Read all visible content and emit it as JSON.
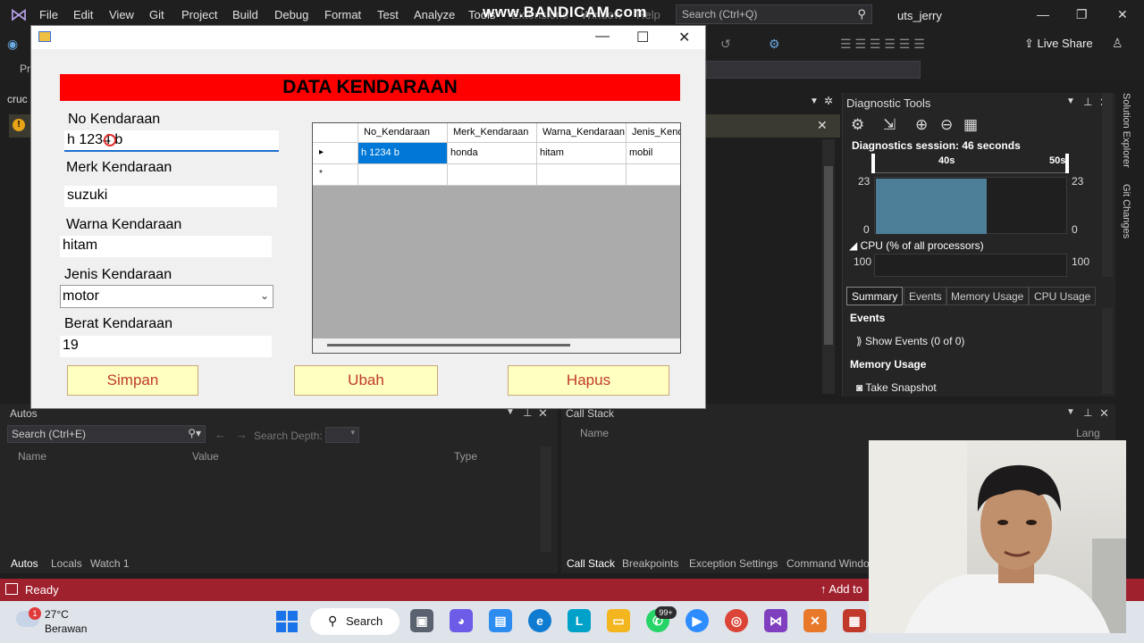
{
  "vs": {
    "menu": [
      "File",
      "Edit",
      "View",
      "Git",
      "Project",
      "Build",
      "Debug",
      "Format",
      "Test",
      "Analyze",
      "Tools",
      "Extensions",
      "Window",
      "Help"
    ],
    "search_placeholder": "Search (Ctrl+Q)",
    "solution_name": "uts_jerry",
    "live_share": "Live Share",
    "editor_tab": "cruc",
    "toolbar_prefix": "Pr",
    "watermark": "www.BANDICAM.com"
  },
  "diagnostics": {
    "title": "Diagnostic Tools",
    "session": "Diagnostics session: 46 seconds",
    "timeline_labels": [
      "40s",
      "50s"
    ],
    "y_top_left": "23",
    "y_bottom_left": "0",
    "y_top_right": "23",
    "y_bottom_right": "0",
    "cpu_header": "CPU (% of all processors)",
    "cpu_y_left": "100",
    "cpu_y_right": "100",
    "tabs": [
      "Summary",
      "Events",
      "Memory Usage",
      "CPU Usage"
    ],
    "events_header": "Events",
    "show_events": "Show Events (0 of 0)",
    "memory_header": "Memory Usage",
    "take_snapshot": "Take Snapshot",
    "side_tabs": [
      "Solution Explorer",
      "Git Changes"
    ]
  },
  "autos": {
    "title": "Autos",
    "search_placeholder": "Search (Ctrl+E)",
    "search_depth": "Search Depth:",
    "columns": [
      "Name",
      "Value",
      "Type"
    ],
    "tabs": [
      "Autos",
      "Locals",
      "Watch 1"
    ]
  },
  "callstack": {
    "title": "Call Stack",
    "columns": [
      "Name",
      "Lang"
    ],
    "tabs": [
      "Call Stack",
      "Breakpoints",
      "Exception Settings",
      "Command Windo"
    ]
  },
  "status": {
    "text": "Ready",
    "add_to": "Add to"
  },
  "taskbar": {
    "temp": "27°C",
    "weather": "Berawan",
    "weather_badge": "1",
    "search": "Search",
    "whatsapp_badge": "99+"
  },
  "form": {
    "banner": "DATA KENDARAAN",
    "no_label": "No Kendaraan",
    "no_value": "h 1234 b",
    "merk_label": "Merk Kendaraan",
    "merk_value": "suzuki",
    "warna_label": "Warna Kendaraan",
    "warna_value": "hitam",
    "jenis_label": "Jenis Kendaraan",
    "jenis_value": "motor",
    "berat_label": "Berat Kendaraan",
    "berat_value": "19",
    "btn_simpan": "Simpan",
    "btn_ubah": "Ubah",
    "btn_hapus": "Hapus",
    "grid": {
      "columns": [
        "No_Kendaraan",
        "Merk_Kendaraan",
        "Warna_Kendaraan",
        "Jenis_Kend"
      ],
      "rows": [
        [
          "h 1234 b",
          "honda",
          "hitam",
          "mobil"
        ]
      ],
      "current_row_marker": "▸",
      "new_row_marker": "*"
    }
  },
  "colors": {
    "status_bar": "#a0212e",
    "banner": "#ff0000",
    "button_bg": "#ffffc0",
    "button_text": "#c0392b",
    "grid_selection": "#0078d7",
    "graph_fill": "#4d7e97"
  }
}
